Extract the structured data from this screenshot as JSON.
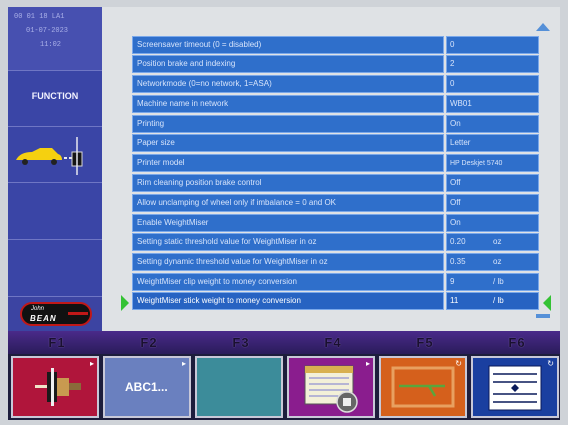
{
  "sidebar": {
    "status_lines": [
      "00 01 18     LA1",
      "01-07-2023",
      "11:02"
    ],
    "function_label": "FUNCTION",
    "logo_text": "John Bean"
  },
  "settings": {
    "rows": [
      {
        "label": "Screensaver timeout (0 = disabled)",
        "value": "0",
        "unit": ""
      },
      {
        "label": "Position brake and indexing",
        "value": "2",
        "unit": ""
      },
      {
        "label": "Networkmode (0=no network, 1=ASA)",
        "value": "0",
        "unit": ""
      },
      {
        "label": "Machine name in network",
        "value": "WB01",
        "unit": ""
      },
      {
        "label": "Printing",
        "value": "On",
        "unit": ""
      },
      {
        "label": "Paper size",
        "value": "Letter",
        "unit": ""
      },
      {
        "label": "Printer model",
        "value": "HP Deskjet 5740",
        "unit": ""
      },
      {
        "label": "Rim cleaning position brake control",
        "value": "Off",
        "unit": ""
      },
      {
        "label": "Allow unclamping of wheel only if imbalance = 0 and OK",
        "value": "Off",
        "unit": ""
      },
      {
        "label": "Enable WeightMiser",
        "value": "On",
        "unit": ""
      },
      {
        "label": "Setting static threshold value for WeightMiser in oz",
        "value": "0.20",
        "unit": "oz"
      },
      {
        "label": "Setting dynamic threshold value for WeightMiser in oz",
        "value": "0.35",
        "unit": "oz"
      },
      {
        "label": "WeightMiser clip weight to money conversion",
        "value": "9",
        "unit": "/ lb"
      },
      {
        "label": "WeightMiser stick weight to money conversion",
        "value": "11",
        "unit": "/ lb"
      }
    ],
    "selected_index": 13
  },
  "function_keys": [
    {
      "key": "F1",
      "icon": "wheel-balancer-icon",
      "color": "#b0153b"
    },
    {
      "key": "F2",
      "text": "ABC1...",
      "color": "#6a80bf"
    },
    {
      "key": "F3",
      "color": "#3c8c9a"
    },
    {
      "key": "F4",
      "icon": "print-report-icon",
      "color": "#8a1d8e"
    },
    {
      "key": "F5",
      "icon": "tool-icon",
      "color": "#d5601c"
    },
    {
      "key": "F6",
      "icon": "scroll-list-icon",
      "color": "#1a3fa0"
    }
  ]
}
